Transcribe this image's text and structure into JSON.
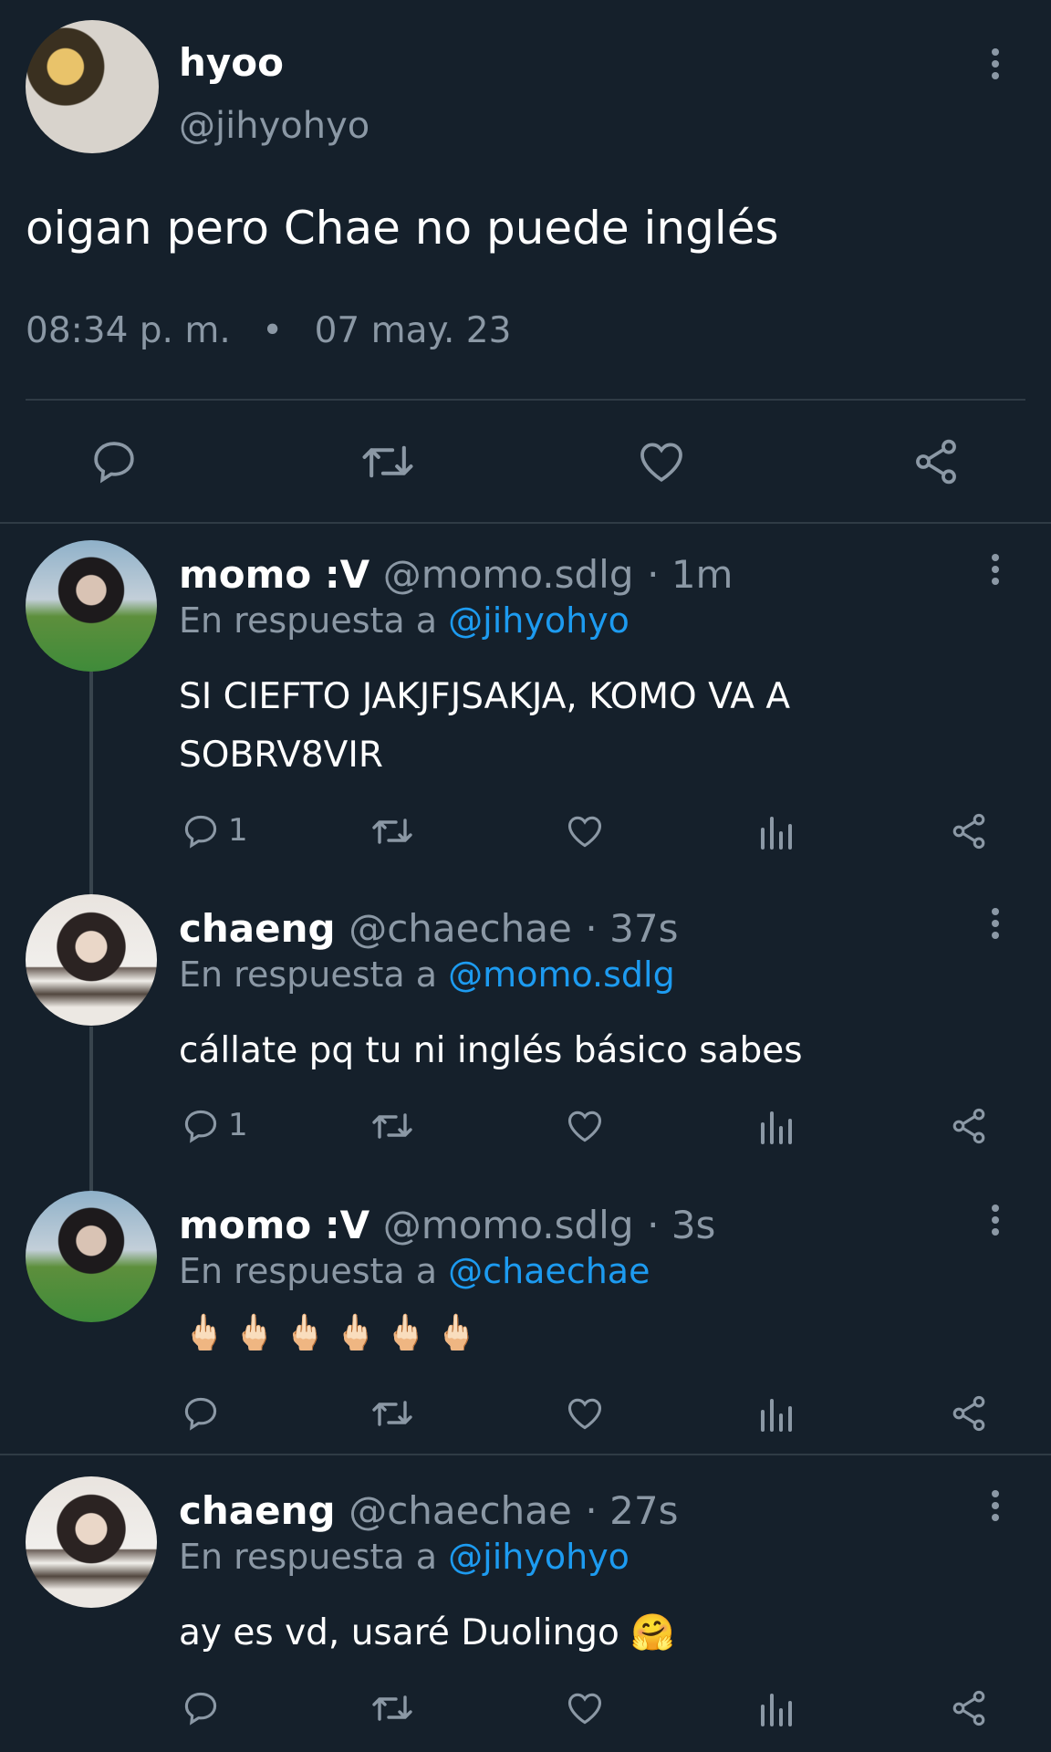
{
  "main_tweet": {
    "author_name": "hyoo",
    "author_handle": "@jihyohyo",
    "text": "oigan pero Chae no puede inglés",
    "time": "08:34 p. m.",
    "separator": "•",
    "date": "07 may. 23"
  },
  "replies": [
    {
      "author_name": "momo :V",
      "author_handle": "@momo.sdlg",
      "time": "· 1m",
      "reply_prefix": "En respuesta a",
      "reply_mention": "@jihyohyo",
      "text_line1": "SI CIEFTO JAKJFJSAKJA, KOMO VA A",
      "text_line2": "SOBRV8VIR",
      "reply_count": "1"
    },
    {
      "author_name": "chaeng",
      "author_handle": "@chaechae",
      "time": "· 37s",
      "reply_prefix": "En respuesta a",
      "reply_mention": "@momo.sdlg",
      "text_line1": "cállate pq tu ni inglés básico sabes",
      "reply_count": "1"
    },
    {
      "author_name": "momo :V",
      "author_handle": "@momo.sdlg",
      "time": "· 3s",
      "reply_prefix": "En respuesta a",
      "reply_mention": "@chaechae",
      "text_line1": "🖕🏻🖕🏻🖕🏻🖕🏻🖕🏻🖕🏻"
    },
    {
      "author_name": "chaeng",
      "author_handle": "@chaechae",
      "time": "· 27s",
      "reply_prefix": "En respuesta a",
      "reply_mention": "@jihyohyo",
      "text_line1": "ay es vd, usaré Duolingo 🤗"
    }
  ],
  "icons": {
    "reply": "reply-icon",
    "retweet": "retweet-icon",
    "like": "heart-icon",
    "views": "views-icon",
    "share": "share-icon",
    "more": "more-vertical-icon"
  },
  "colors": {
    "background": "#15202b",
    "muted": "#8b98a5",
    "mention": "#1d9bf0",
    "divider": "#2f3b45"
  }
}
